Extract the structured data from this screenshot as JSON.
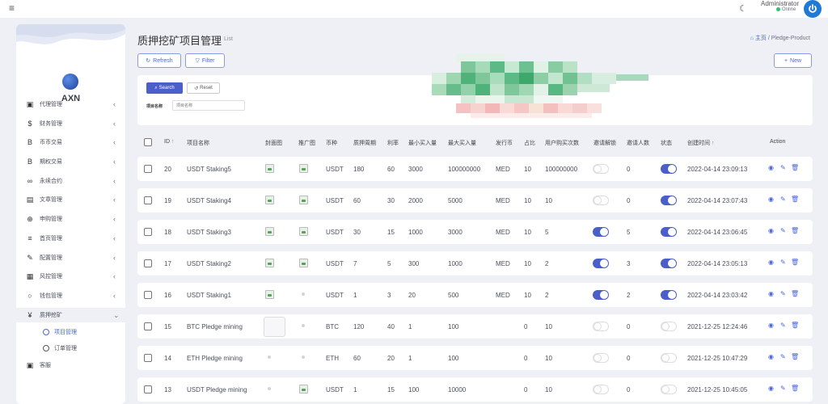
{
  "topbar": {
    "admin_name": "Administrator",
    "status": "Online"
  },
  "sidebar": {
    "brand": "AXN",
    "items": [
      {
        "icon": "id-card-icon",
        "glyph": "▣",
        "label": "代理管理"
      },
      {
        "icon": "dollar-icon",
        "glyph": "$",
        "label": "财务管理"
      },
      {
        "icon": "bitcoin-icon",
        "glyph": "B",
        "label": "币币交易"
      },
      {
        "icon": "bitcoin-icon",
        "glyph": "B",
        "label": "期权交易"
      },
      {
        "icon": "link-icon",
        "glyph": "∞",
        "label": "永续合约"
      },
      {
        "icon": "newspaper-icon",
        "glyph": "▤",
        "label": "文章管理"
      },
      {
        "icon": "globe-icon",
        "glyph": "⊕",
        "label": "申购管理"
      },
      {
        "icon": "list-icon",
        "glyph": "≡",
        "label": "首页管理"
      },
      {
        "icon": "wrench-icon",
        "glyph": "✎",
        "label": "配置管理"
      },
      {
        "icon": "table-icon",
        "glyph": "▦",
        "label": "风控管理"
      },
      {
        "icon": "circle-icon",
        "glyph": "○",
        "label": "钱包管理"
      },
      {
        "icon": "yen-icon",
        "glyph": "¥",
        "label": "质押挖矿"
      }
    ],
    "sub_items": [
      "项目管理",
      "订单管理"
    ],
    "last_item": {
      "icon": "chat-icon",
      "glyph": "▣",
      "label": "客服"
    }
  },
  "header": {
    "title": "质押挖矿项目管理",
    "subtitle": "List",
    "breadcrumb_home": "主页",
    "breadcrumb_sep": "/",
    "breadcrumb_current": "Pledge-Product",
    "refresh_label": "Refresh",
    "filter_label": "Filter",
    "new_label": "New"
  },
  "search": {
    "search_label": "Search",
    "reset_label": "Reset",
    "field_label": "项目名称",
    "field_placeholder": "项目名称"
  },
  "table": {
    "headers": {
      "id": "ID",
      "name": "项目名称",
      "cover": "封面图",
      "promo": "推广图",
      "coin": "币种",
      "period": "质押周期",
      "rate": "利率",
      "min": "最小买入量",
      "max": "最大买入量",
      "issue": "发行币",
      "share": "占比",
      "buy_count": "用户购买次数",
      "invite_unlock": "邀请解锁",
      "invite_num": "邀请人数",
      "status": "状态",
      "created": "创建时间",
      "action": "Action"
    },
    "rows": [
      {
        "id": "20",
        "name": "USDT Staking5",
        "coin": "USDT",
        "period": "180",
        "rate": "60",
        "min": "3000",
        "max": "100000000",
        "issue": "MED",
        "share": "10",
        "buy_count": "100000000",
        "invite_num": "0",
        "created": "2022-04-14 23:09:13",
        "cover": true,
        "promo": true,
        "invite_unlock": false,
        "status": true
      },
      {
        "id": "19",
        "name": "USDT Staking4",
        "coin": "USDT",
        "period": "60",
        "rate": "30",
        "min": "2000",
        "max": "5000",
        "issue": "MED",
        "share": "10",
        "buy_count": "10",
        "invite_num": "0",
        "created": "2022-04-14 23:07:43",
        "cover": true,
        "promo": true,
        "invite_unlock": false,
        "status": true
      },
      {
        "id": "18",
        "name": "USDT Staking3",
        "coin": "USDT",
        "period": "30",
        "rate": "15",
        "min": "1000",
        "max": "3000",
        "issue": "MED",
        "share": "10",
        "buy_count": "5",
        "invite_num": "5",
        "created": "2022-04-14 23:06:45",
        "cover": true,
        "promo": true,
        "invite_unlock": true,
        "status": true
      },
      {
        "id": "17",
        "name": "USDT Staking2",
        "coin": "USDT",
        "period": "7",
        "rate": "5",
        "min": "300",
        "max": "1000",
        "issue": "MED",
        "share": "10",
        "buy_count": "2",
        "invite_num": "3",
        "created": "2022-04-14 23:05:13",
        "cover": true,
        "promo": true,
        "invite_unlock": true,
        "status": true
      },
      {
        "id": "16",
        "name": "USDT Staking1",
        "coin": "USDT",
        "period": "1",
        "rate": "3",
        "min": "20",
        "max": "500",
        "issue": "MED",
        "share": "10",
        "buy_count": "2",
        "invite_num": "2",
        "created": "2022-04-14 23:03:42",
        "cover": true,
        "promo": false,
        "invite_unlock": true,
        "status": true
      },
      {
        "id": "15",
        "name": "BTC Pledge mining",
        "coin": "BTC",
        "period": "120",
        "rate": "40",
        "min": "1",
        "max": "100",
        "issue": "",
        "share": "0",
        "buy_count": "10",
        "invite_num": "0",
        "created": "2021-12-25 12:24:46",
        "cover": "thumb",
        "promo": false,
        "invite_unlock": false,
        "status": false
      },
      {
        "id": "14",
        "name": "ETH Pledge mining",
        "coin": "ETH",
        "period": "60",
        "rate": "20",
        "min": "1",
        "max": "100",
        "issue": "",
        "share": "0",
        "buy_count": "10",
        "invite_num": "0",
        "created": "2021-12-25 10:47:29",
        "cover": false,
        "promo": false,
        "invite_unlock": false,
        "status": false
      },
      {
        "id": "13",
        "name": "USDT Pledge mining",
        "coin": "USDT",
        "period": "1",
        "rate": "15",
        "min": "100",
        "max": "10000",
        "issue": "",
        "share": "0",
        "buy_count": "10",
        "invite_num": "0",
        "created": "2021-12-25 10:45:05",
        "cover": false,
        "promo": true,
        "invite_unlock": false,
        "status": false
      }
    ]
  },
  "colors": {
    "accent": "#4a5fc9",
    "link": "#4a66d9",
    "power": "#1e7ad6",
    "online": "#28c76f"
  }
}
